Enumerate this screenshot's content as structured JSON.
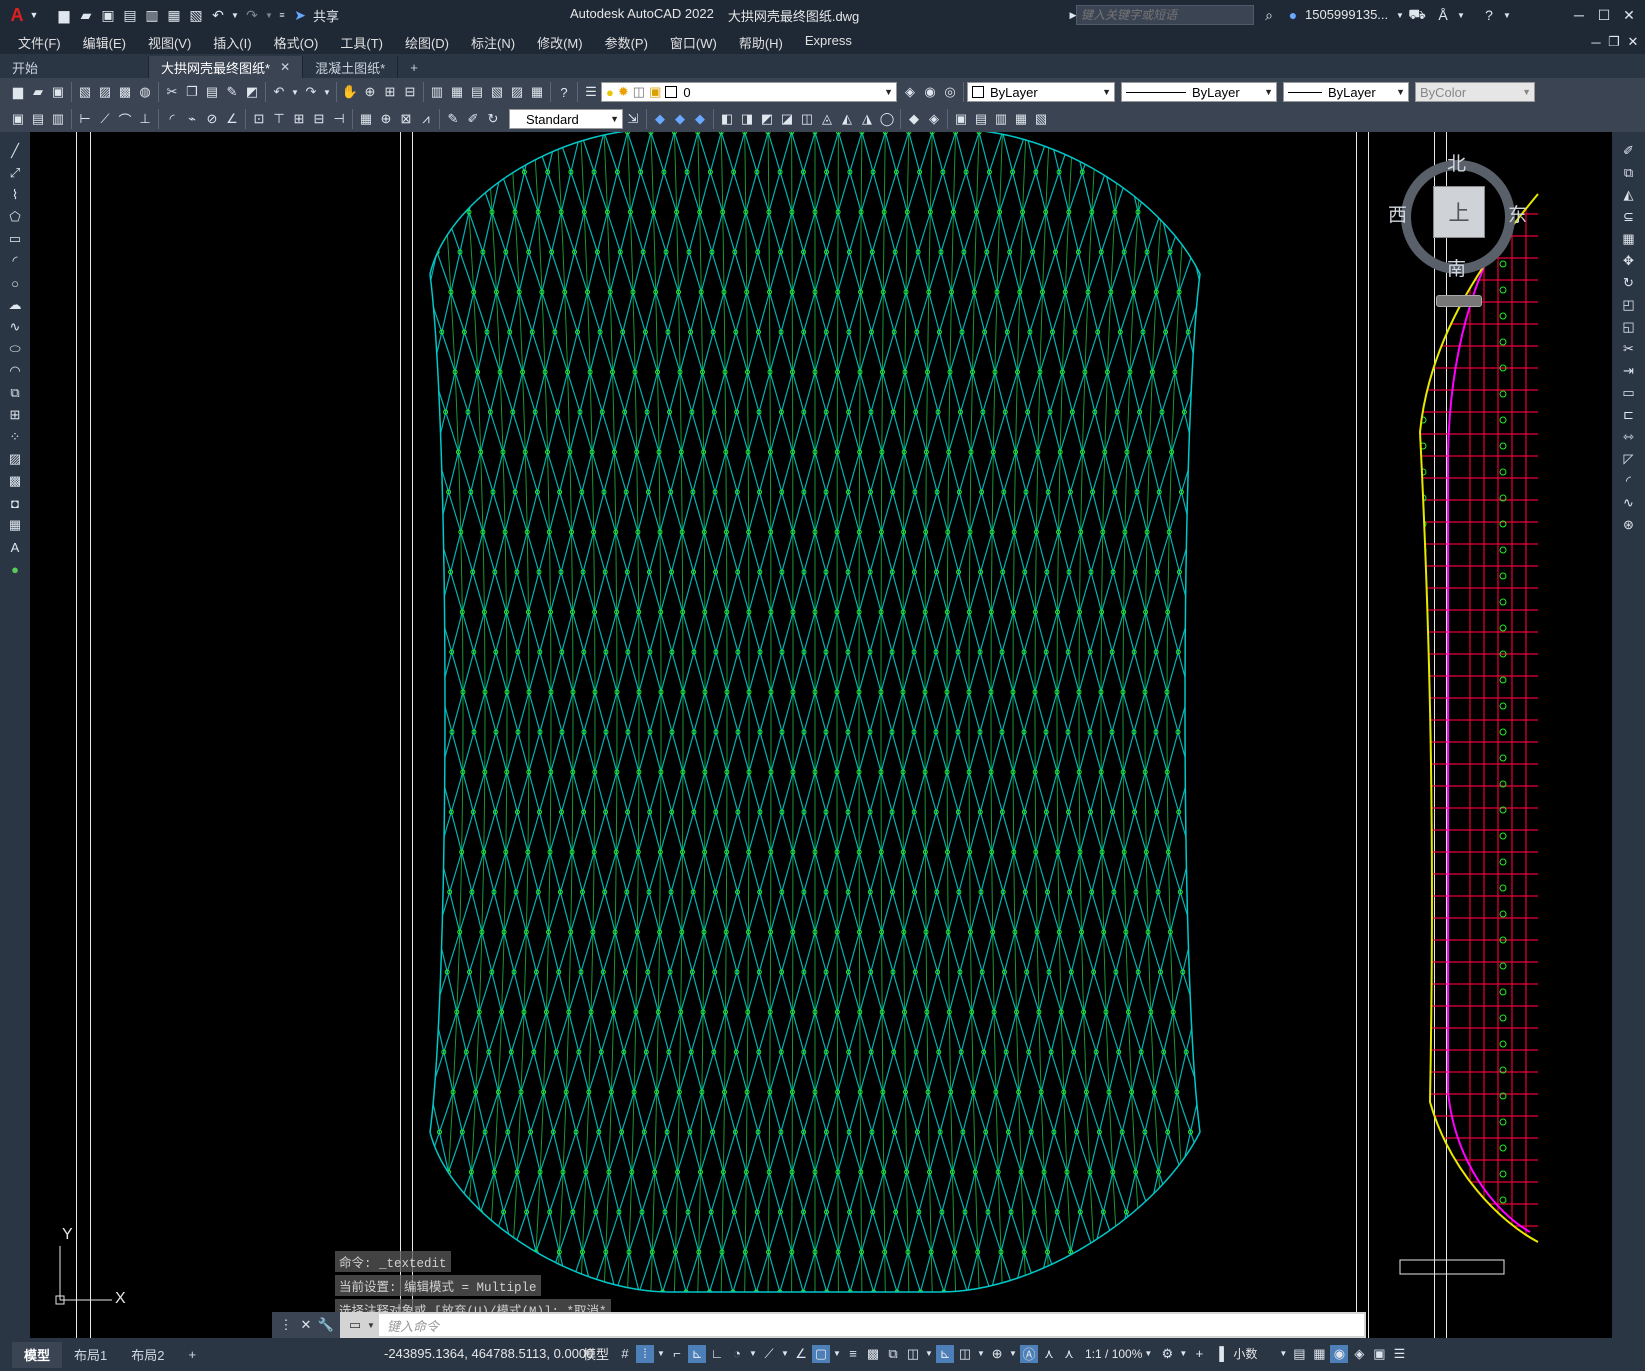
{
  "title_bar": {
    "app_title": "Autodesk AutoCAD 2022",
    "file_title": "大拱网壳最终图纸.dwg",
    "share_label": "共享",
    "search_placeholder": "键入关键字或短语",
    "user_name": "1505999135..."
  },
  "menu": [
    "文件(F)",
    "编辑(E)",
    "视图(V)",
    "插入(I)",
    "格式(O)",
    "工具(T)",
    "绘图(D)",
    "标注(N)",
    "修改(M)",
    "参数(P)",
    "窗口(W)",
    "帮助(H)",
    "Express"
  ],
  "doc_tabs": [
    {
      "label": "开始",
      "closable": false
    },
    {
      "label": "大拱网壳最终图纸*",
      "closable": true
    },
    {
      "label": "混凝土图纸*",
      "closable": false
    }
  ],
  "toolbar": {
    "layer_value": "0",
    "color_value": "ByLayer",
    "linetype_value": "ByLayer",
    "lineweight_value": "ByLayer",
    "plotstyle_value": "ByColor",
    "text_style": "Standard"
  },
  "viewcube": {
    "north": "北",
    "south": "南",
    "east": "东",
    "west": "西",
    "face": "上"
  },
  "ucs": {
    "x": "X",
    "y": "Y"
  },
  "command": {
    "history": [
      "命令:  _textedit",
      "当前设置: 编辑模式 = Multiple",
      "选择注释对象或 [放弃(U)/模式(M)]: *取消*"
    ],
    "placeholder": "键入命令"
  },
  "layout_tabs": [
    "模型",
    "布局1",
    "布局2"
  ],
  "status": {
    "coords": "-243895.1364, 464788.5113, 0.0000",
    "space": "模型",
    "scale": "1:1 / 100%",
    "units": "小数"
  },
  "colors": {
    "mesh_cyan": "#00c8c8",
    "mesh_green": "#22c84a",
    "node_green": "#22ee22",
    "grid_magenta": "#ff00ff",
    "grid_red": "#e8003a",
    "edge_yellow": "#e8e800",
    "chrome_dark": "#1f2936",
    "chrome_mid": "#3b4453"
  }
}
